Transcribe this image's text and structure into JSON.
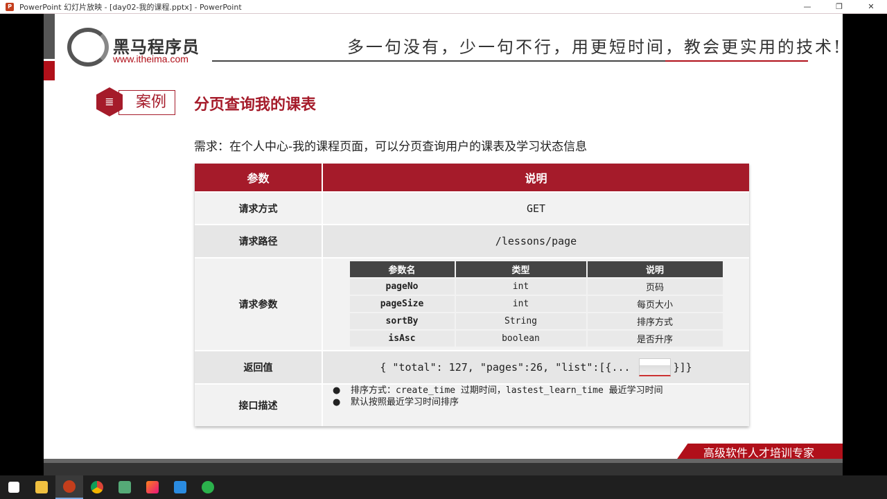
{
  "window": {
    "title": "PowerPoint 幻灯片放映 - [day02-我的课程.pptx] - PowerPoint",
    "app_icon": "P",
    "minimize": "—",
    "maximize": "❐",
    "close": "✕"
  },
  "slide": {
    "brand": "黑马程序员",
    "url": "www.itheima.com",
    "slogan": "多一句没有，少一句不行，用更短时间，教会更实用的技术!",
    "tag": "案例",
    "tag_icon": "≣",
    "title": "分页查询我的课表",
    "requirement": "需求：在个人中心-我的课程页面，可以分页查询用户的课表及学习状态信息",
    "table": {
      "headers": [
        "参数",
        "说明"
      ],
      "method_label": "请求方式",
      "method": "GET",
      "path_label": "请求路径",
      "path": "/lessons/page",
      "params_label": "请求参数",
      "params_headers": [
        "参数名",
        "类型",
        "说明"
      ],
      "params": [
        {
          "name": "pageNo",
          "type": "int",
          "desc": "页码"
        },
        {
          "name": "pageSize",
          "type": "int",
          "desc": "每页大小"
        },
        {
          "name": "sortBy",
          "type": "String",
          "desc": "排序方式"
        },
        {
          "name": "isAsc",
          "type": "boolean",
          "desc": "是否升序"
        }
      ],
      "return_label": "返回值",
      "return_pre": "{ \"total\": 127, \"pages\":26, \"list\":[{...",
      "return_post": "}]}",
      "desc_label": "接口描述",
      "desc": [
        "排序方式：create_time 过期时间，lastest_learn_time 最近学习时间",
        "默认按照最近学习时间排序"
      ],
      "bullet": "●"
    },
    "footer": "高级软件人才培训专家"
  },
  "colors": {
    "accent": "#a51b2a"
  }
}
